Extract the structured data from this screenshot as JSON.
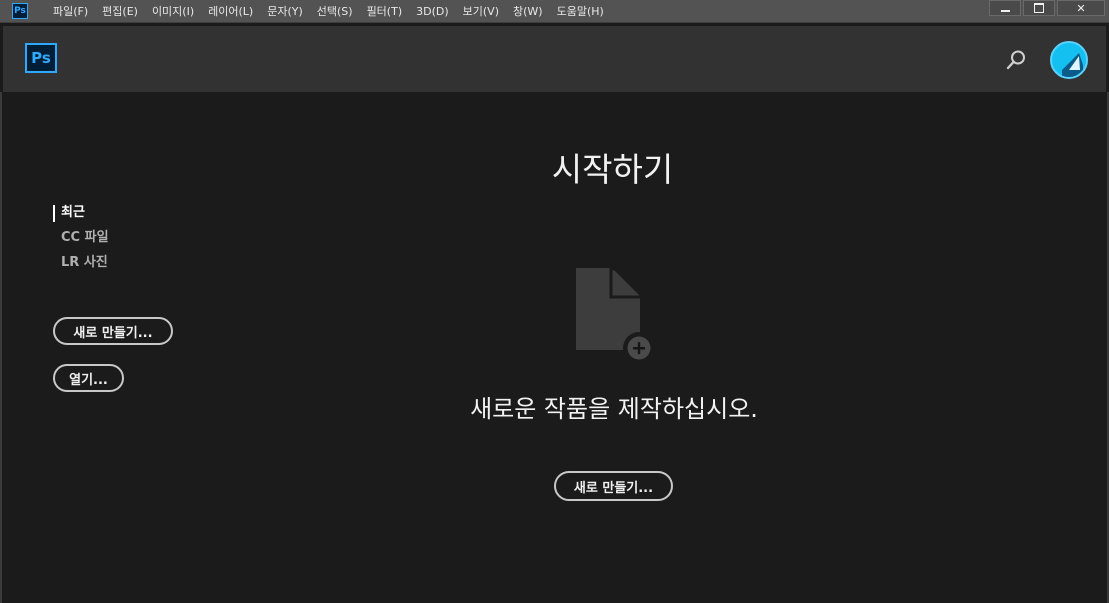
{
  "app": {
    "icon_text": "Ps"
  },
  "menubar": {
    "items": [
      "파일(F)",
      "편집(E)",
      "이미지(I)",
      "레이어(L)",
      "문자(Y)",
      "선택(S)",
      "필터(T)",
      "3D(D)",
      "보기(V)",
      "창(W)",
      "도움말(H)"
    ]
  },
  "window": {
    "close_glyph": "✕"
  },
  "header": {
    "logo_text": "Ps"
  },
  "sidebar": {
    "items": [
      "최근",
      "CC 파일",
      "LR 사진"
    ],
    "active_index": 0,
    "new_button": "새로 만들기...",
    "open_button": "열기..."
  },
  "main": {
    "title": "시작하기",
    "create_text": "새로운 작품을 제작하십시오.",
    "new_button": "새로 만들기..."
  },
  "colors": {
    "accent": "#31a8ff",
    "avatar": "#14c0f0",
    "background": "#1b1b1b"
  }
}
